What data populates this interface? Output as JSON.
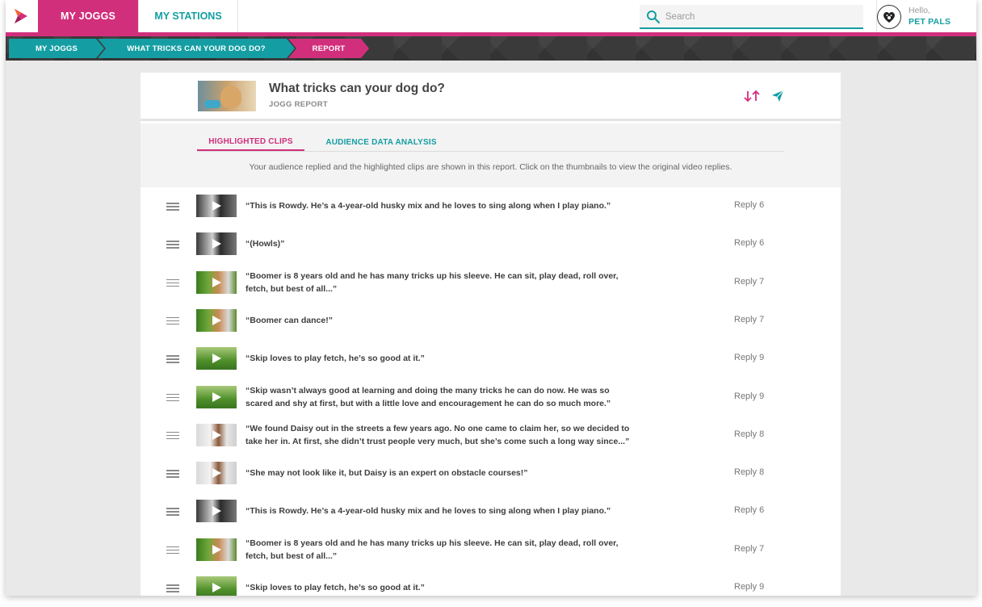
{
  "nav": {
    "tab_my_joggs": "MY JOGGS",
    "tab_my_stations": "MY STATIONS",
    "search_placeholder": "Search",
    "greeting": "Hello,",
    "username": "PET PALS"
  },
  "breadcrumb": [
    "MY JOGGS",
    "WHAT TRICKS CAN YOUR DOG DO?",
    "REPORT"
  ],
  "header": {
    "title": "What tricks can your dog do?",
    "subtitle": "JOGG REPORT"
  },
  "tabs": {
    "highlighted": "HIGHLIGHTED CLIPS",
    "audience": "AUDIENCE DATA ANALYSIS"
  },
  "description": "Your audience replied and the highlighted clips are shown in this report. Click on the thumbnails to view the original video replies.",
  "clips": [
    {
      "line1": "“This is Rowdy. He’s a 4-year-old husky mix and he loves to sing along when I play piano.”",
      "line2": "",
      "reply": "Reply 6",
      "thumb": "husky"
    },
    {
      "line1": "“(Howls)”",
      "line2": "",
      "reply": "Reply 6",
      "thumb": "husky"
    },
    {
      "line1": "“Boomer is 8 years old and he has many tricks up his sleeve. He can sit, play dead, roll over,",
      "line2": "fetch, but best of all...”",
      "reply": "Reply 7",
      "thumb": "boomer"
    },
    {
      "line1": "“Boomer can dance!”",
      "line2": "",
      "reply": "Reply 7",
      "thumb": "boomer"
    },
    {
      "line1": "“Skip loves to play fetch, he’s so good at it.”",
      "line2": "",
      "reply": "Reply 9",
      "thumb": "skip"
    },
    {
      "line1": "“Skip wasn’t always good at learning and doing the many tricks he can do now. He was so",
      "line2": "scared and shy at first, but with a little love and encouragement he can do so much more.”",
      "reply": "Reply 9",
      "thumb": "skip"
    },
    {
      "line1": "“We found Daisy out in the streets a few years ago. No one came to claim her, so we decided to",
      "line2": "take her in. At first, she didn’t trust people very much, but she’s come such a long way since...”",
      "reply": "Reply 8",
      "thumb": "daisy"
    },
    {
      "line1": "“She may not look like it, but Daisy is an expert on obstacle courses!”",
      "line2": "",
      "reply": "Reply 8",
      "thumb": "daisy"
    },
    {
      "line1": "“This is Rowdy. He’s a 4-year-old husky mix and he loves to sing along when I play piano.”",
      "line2": "",
      "reply": "Reply 6",
      "thumb": "husky"
    },
    {
      "line1": "“Boomer is 8 years old and he has many tricks up his sleeve. He can sit, play dead, roll over,",
      "line2": "fetch, but best of all...”",
      "reply": "Reply 7",
      "thumb": "boomer"
    },
    {
      "line1": "“Skip loves to play fetch, he’s so good at it.”",
      "line2": "",
      "reply": "Reply 9",
      "thumb": "skip"
    }
  ],
  "colors": {
    "brand_pink": "#d12f7c",
    "brand_teal": "#149ea3"
  }
}
